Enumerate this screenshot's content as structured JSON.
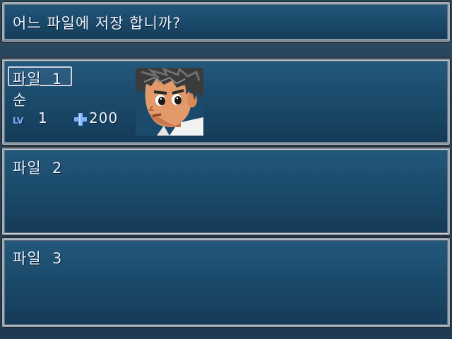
{
  "dialog": {
    "prompt": "어느 파일에 저장 합니까?"
  },
  "save_slots": [
    {
      "label": "파일  1",
      "selected": true,
      "character_name": "순",
      "level_label": "LV",
      "level": "1",
      "gold": "200",
      "gold_icon": "plus-cross-icon",
      "portrait": "hero-face-portrait"
    },
    {
      "label": "파일  2",
      "selected": false
    },
    {
      "label": "파일  3",
      "selected": false
    }
  ],
  "colors": {
    "window_top": "#24597d",
    "window_bottom": "#143a57",
    "text": "#e9f1ff",
    "accent": "#7fb2ff"
  }
}
